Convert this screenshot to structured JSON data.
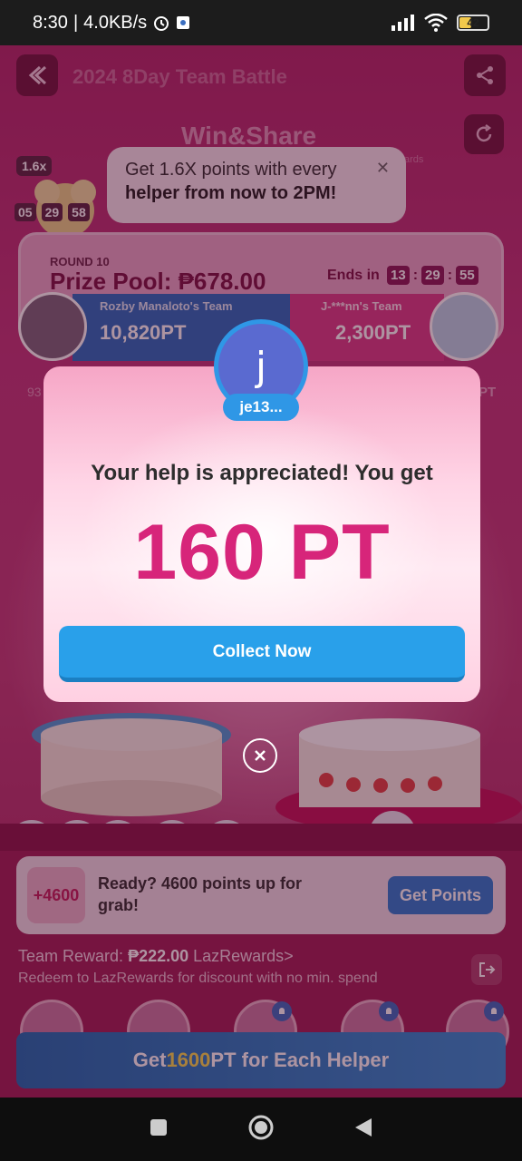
{
  "status_bar": {
    "time": "8:30",
    "speed": "4.0KB/s",
    "battery": "42"
  },
  "page": {
    "title": "2024 8Day Team Battle",
    "banner_text": "Win&Share",
    "tooltip_tail": "ards"
  },
  "tooltip": {
    "line1": "Get 1.6X points with every",
    "line2": "helper from now to 2PM!"
  },
  "multiplier": {
    "label": "1.6x",
    "timer": [
      "05",
      "29",
      "58"
    ]
  },
  "battle": {
    "round": "ROUND 10",
    "prize_pool": "Prize Pool: ₱678.00",
    "ends_in_label": "Ends in",
    "ends_timer": [
      "13",
      "29",
      "55"
    ],
    "team_left_name": "Rozby Manaloto's Team",
    "team_left_points": "10,820PT",
    "team_right_name": "J-***nn's Team",
    "team_right_points": "2,300PT",
    "left_progress_num": "93",
    "right_pt_fragment": "PT"
  },
  "modal": {
    "avatar_letter": "j",
    "username": "je13...",
    "message": "Your help is appreciated! You get",
    "points": "160 PT",
    "button_label": "Collect Now"
  },
  "points_card": {
    "badge": "+4600",
    "text": "Ready? 4600 points up for grab!",
    "button_label": "Get Points"
  },
  "team_reward": {
    "label": "Team Reward:",
    "amount": "₱222.00",
    "link": "LazRewards>",
    "subtitle": "Redeem to LazRewards for discount with no min. spend"
  },
  "cta": {
    "prefix": "Get ",
    "highlight": "1600",
    "suffix": " PT for Each Helper"
  },
  "colors": {
    "accent_pink": "#d7257a",
    "button_blue": "#29a0ea",
    "background_magenta": "#b22d6c"
  },
  "icons": [
    "back-arrow-icon",
    "share-icon",
    "refresh-icon",
    "close-icon",
    "wifi-icon",
    "signal-icon",
    "battery-icon",
    "alarm-icon",
    "bell-icon",
    "exit-icon",
    "nav-square-icon",
    "nav-circle-icon",
    "nav-back-icon"
  ]
}
